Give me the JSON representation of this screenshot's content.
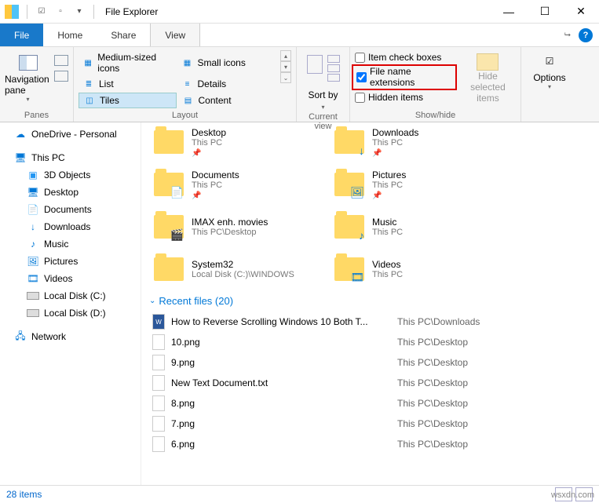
{
  "window": {
    "title": "File Explorer"
  },
  "menu": {
    "file": "File",
    "tabs": [
      "Home",
      "Share",
      "View"
    ],
    "active": "View"
  },
  "ribbon": {
    "panes": {
      "label": "Navigation pane",
      "group": "Panes"
    },
    "layout": {
      "group": "Layout",
      "items": [
        [
          "Medium-sized icons",
          "Small icons"
        ],
        [
          "List",
          "Details"
        ],
        [
          "Tiles",
          "Content"
        ]
      ],
      "selected": "Tiles"
    },
    "current_view": {
      "sort": "Sort by",
      "group": "Current view"
    },
    "showhide": {
      "group": "Show/hide",
      "item_check": "Item check boxes",
      "file_ext": "File name extensions",
      "hidden": "Hidden items",
      "hide_btn": "Hide selected items"
    },
    "options": "Options"
  },
  "nav": {
    "onedrive": "OneDrive - Personal",
    "thispc": "This PC",
    "items": [
      "3D Objects",
      "Desktop",
      "Documents",
      "Downloads",
      "Music",
      "Pictures",
      "Videos",
      "Local Disk (C:)",
      "Local Disk (D:)"
    ],
    "network": "Network"
  },
  "folders": [
    {
      "name": "Desktop",
      "sub": "This PC",
      "pinned": true,
      "overlay": ""
    },
    {
      "name": "Downloads",
      "sub": "This PC",
      "pinned": true,
      "overlay": "↓"
    },
    {
      "name": "Documents",
      "sub": "This PC",
      "pinned": true,
      "overlay": "📄"
    },
    {
      "name": "Pictures",
      "sub": "This PC",
      "pinned": true,
      "overlay": "🖼"
    },
    {
      "name": "IMAX enh. movies",
      "sub": "This PC\\Desktop",
      "pinned": false,
      "overlay": "🎬"
    },
    {
      "name": "Music",
      "sub": "This PC",
      "pinned": false,
      "overlay": "♪"
    },
    {
      "name": "System32",
      "sub": "Local Disk (C:)\\WINDOWS",
      "pinned": false,
      "overlay": ""
    },
    {
      "name": "Videos",
      "sub": "This PC",
      "pinned": false,
      "overlay": "🎞"
    }
  ],
  "recent": {
    "header": "Recent files (20)",
    "items": [
      {
        "name": "How to Reverse Scrolling Windows 10 Both T...",
        "path": "This PC\\Downloads",
        "type": "doc"
      },
      {
        "name": "10.png",
        "path": "This PC\\Desktop",
        "type": "img"
      },
      {
        "name": "9.png",
        "path": "This PC\\Desktop",
        "type": "img"
      },
      {
        "name": "New Text Document.txt",
        "path": "This PC\\Desktop",
        "type": "txt"
      },
      {
        "name": "8.png",
        "path": "This PC\\Desktop",
        "type": "img"
      },
      {
        "name": "7.png",
        "path": "This PC\\Desktop",
        "type": "img"
      },
      {
        "name": "6.png",
        "path": "This PC\\Desktop",
        "type": "img"
      }
    ]
  },
  "status": {
    "count": "28 items"
  },
  "watermark": "wsxdn.com"
}
